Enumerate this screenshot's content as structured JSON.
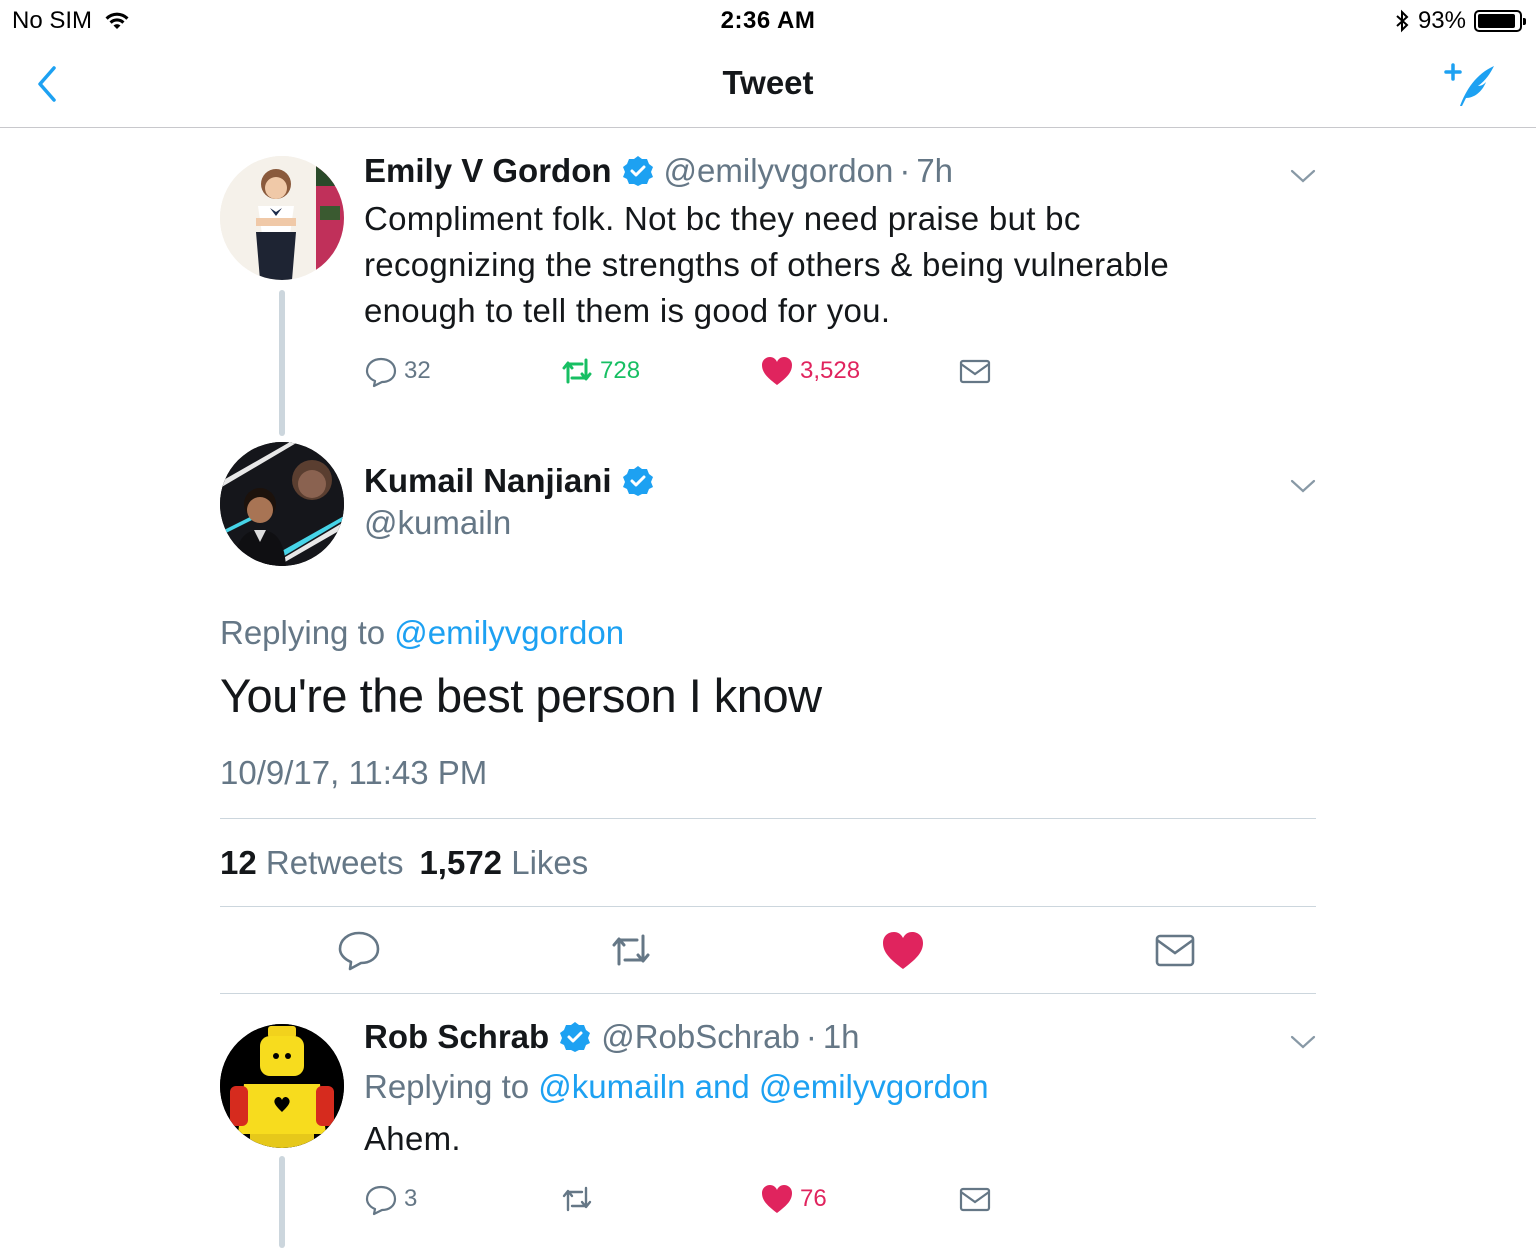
{
  "status_bar": {
    "carrier": "No SIM",
    "time": "2:36 AM",
    "battery_percent": "93%",
    "battery_level": 0.93
  },
  "nav": {
    "title": "Tweet",
    "back_icon": "chevron-left-icon",
    "compose_icon": "compose-tweet-icon"
  },
  "colors": {
    "accent": "#1da1f2",
    "retweet_green": "#17bf63",
    "like_red": "#e0245e",
    "secondary_text": "#657786"
  },
  "parent_tweet": {
    "name": "Emily V Gordon",
    "handle": "@emilyvgordon",
    "time": "7h",
    "text": "Compliment folk. Not bc they need praise but bc recognizing the strengths of others & being vulnerable enough to tell them is good for you.",
    "replies": "32",
    "retweets": "728",
    "likes": "3,528"
  },
  "main_tweet": {
    "name": "Kumail Nanjiani",
    "handle": "@kumailn",
    "replying_label": "Replying to",
    "replying_to": "@emilyvgordon",
    "text": "You're the best person I know",
    "timestamp": "10/9/17, 11:43 PM",
    "retweets_count": "12",
    "retweets_label": "Retweets",
    "likes_count": "1,572",
    "likes_label": "Likes"
  },
  "reply_tweet": {
    "name": "Rob Schrab",
    "handle": "@RobSchrab",
    "time": "1h",
    "replying_label": "Replying to",
    "replying_to": "@kumailn and @emilyvgordon",
    "text": "Ahem.",
    "replies": "3",
    "likes": "76"
  }
}
